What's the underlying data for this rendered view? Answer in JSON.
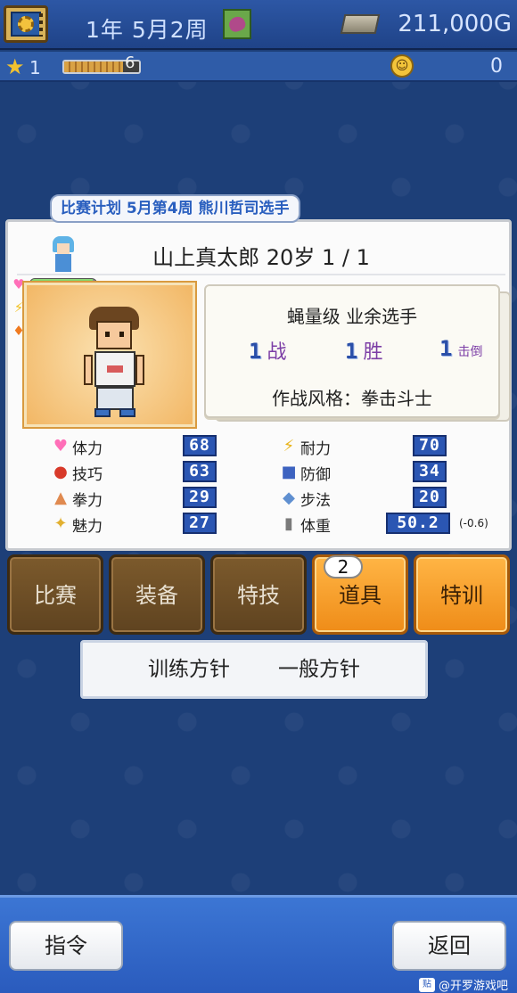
{
  "topbar": {
    "date": "1年 5月2周",
    "money": "211,000G"
  },
  "status": {
    "stars": "1",
    "exp_value": "6",
    "exp_fraction": 0.78,
    "fans": "0"
  },
  "match_plan": "比赛计划 5月第4周 熊川哲司选手",
  "player": {
    "name_line": "山上真太郎 20岁 1 / 1",
    "gauges": [
      {
        "icon": "heart-icon",
        "fill": 0.95
      },
      {
        "icon": "lightning-icon",
        "fill": 0.28
      },
      {
        "icon": "fire-icon",
        "fill": 0.22
      }
    ],
    "rank": "蝇量级 业余选手",
    "record": {
      "bouts": "1",
      "bouts_label": "战",
      "wins": "1",
      "wins_label": "胜",
      "ko": "1",
      "ko_label": "击倒"
    },
    "style": "作战风格：拳击斗士"
  },
  "attributes": {
    "left": [
      {
        "icon": "heart-icon",
        "label": "体力",
        "value": "68"
      },
      {
        "icon": "glove-icon",
        "label": "技巧",
        "value": "63"
      },
      {
        "icon": "muscle-icon",
        "label": "拳力",
        "value": "29"
      },
      {
        "icon": "sparkle-icon",
        "label": "魅力",
        "value": "27"
      }
    ],
    "right": [
      {
        "icon": "lightning-icon",
        "label": "耐力",
        "value": "70"
      },
      {
        "icon": "shield-icon",
        "label": "防御",
        "value": "34"
      },
      {
        "icon": "shoe-icon",
        "label": "步法",
        "value": "20"
      },
      {
        "icon": "weight-icon",
        "label": "体重",
        "value": "50.2"
      }
    ],
    "weight_delta": "(-0.6)"
  },
  "tabs": [
    {
      "label": "比赛",
      "active": false
    },
    {
      "label": "装备",
      "active": false
    },
    {
      "label": "特技",
      "active": false
    },
    {
      "label": "道具",
      "active": true,
      "badge": "2"
    },
    {
      "label": "特训",
      "active": true
    }
  ],
  "policy": {
    "label": "训练方针",
    "value": "一般方针"
  },
  "bottom": {
    "command": "指令",
    "back": "返回",
    "watermark": "@开罗游戏吧",
    "watermark_badge": "贴"
  },
  "colors": {
    "background": "#1d3f78",
    "tab_inactive": "#6e4f26",
    "tab_active": "#f6a22c",
    "stat_badge": "#2b56b3",
    "record_label": "#7c3ea6"
  }
}
